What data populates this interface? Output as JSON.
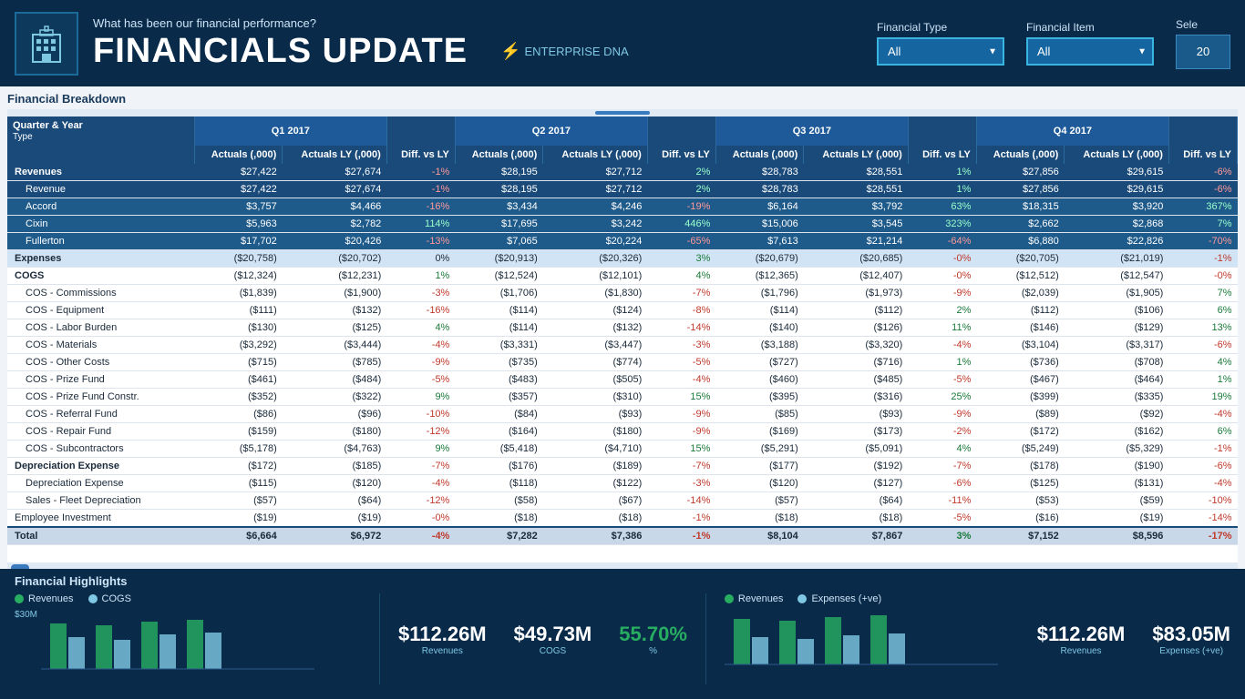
{
  "header": {
    "subtitle": "What has been our financial performance?",
    "title": "FINANCIALS UPDATE",
    "brand": "ENTERPRISE DNA",
    "financial_type_label": "Financial Type",
    "financial_item_label": "Financial Item",
    "select_label": "Sele",
    "financial_type_value": "All",
    "financial_item_value": "All",
    "year_value": "20"
  },
  "table": {
    "section_title": "Financial Breakdown",
    "col_headers": [
      "Quarter & Year",
      "Q1 2017\nActuals (,000)",
      "Actuals LY (,000)",
      "Diff. vs LY",
      "Q2 2017\nActuals (,000)",
      "Actuals LY (,000)",
      "Diff. vs LY",
      "Q3 2017\nActuals (,000)",
      "Actuals LY (,000)",
      "Diff. vs LY",
      "Q4 2017\nActuals (,000)",
      "Actuals LY (,000)",
      "Diff. vs LY"
    ],
    "rows": [
      {
        "label": "Revenues",
        "indent": false,
        "bold": true,
        "group": true,
        "q1a": "$27,422",
        "q1ly": "$27,674",
        "q1d": "-1%",
        "q2a": "$28,195",
        "q2ly": "$27,712",
        "q2d": "2%",
        "q3a": "$28,783",
        "q3ly": "$28,551",
        "q3d": "1%",
        "q4a": "$27,856",
        "q4ly": "$29,615",
        "q4d": "-6%",
        "highlight": true
      },
      {
        "label": "Revenue",
        "indent": true,
        "bold": false,
        "q1a": "$27,422",
        "q1ly": "$27,674",
        "q1d": "-1%",
        "q2a": "$28,195",
        "q2ly": "$27,712",
        "q2d": "2%",
        "q3a": "$28,783",
        "q3ly": "$28,551",
        "q3d": "1%",
        "q4a": "$27,856",
        "q4ly": "$29,615",
        "q4d": "-6%",
        "highlight": true
      },
      {
        "label": "Accord",
        "indent": true,
        "bold": false,
        "q1a": "$3,757",
        "q1ly": "$4,466",
        "q1d": "-16%",
        "q2a": "$3,434",
        "q2ly": "$4,246",
        "q2d": "-19%",
        "q3a": "$6,164",
        "q3ly": "$3,792",
        "q3d": "63%",
        "q4a": "$18,315",
        "q4ly": "$3,920",
        "q4d": "367%",
        "highlight2": true
      },
      {
        "label": "Cixin",
        "indent": true,
        "bold": false,
        "q1a": "$5,963",
        "q1ly": "$2,782",
        "q1d": "114%",
        "q2a": "$17,695",
        "q2ly": "$3,242",
        "q2d": "446%",
        "q3a": "$15,006",
        "q3ly": "$3,545",
        "q3d": "323%",
        "q4a": "$2,662",
        "q4ly": "$2,868",
        "q4d": "7%",
        "highlight2": true
      },
      {
        "label": "Fullerton",
        "indent": true,
        "bold": false,
        "q1a": "$17,702",
        "q1ly": "$20,426",
        "q1d": "-13%",
        "q2a": "$7,065",
        "q2ly": "$20,224",
        "q2d": "-65%",
        "q3a": "$7,613",
        "q3ly": "$21,214",
        "q3d": "-64%",
        "q4a": "$6,880",
        "q4ly": "$22,826",
        "q4d": "-70%",
        "highlight2": true
      },
      {
        "label": "Expenses",
        "indent": false,
        "bold": true,
        "group": true,
        "q1a": "($20,758)",
        "q1ly": "($20,702)",
        "q1d": "0%",
        "q2a": "($20,913)",
        "q2ly": "($20,326)",
        "q2d": "3%",
        "q3a": "($20,679)",
        "q3ly": "($20,685)",
        "q3d": "-0%",
        "q4a": "($20,705)",
        "q4ly": "($21,019)",
        "q4d": "-1%"
      },
      {
        "label": "COGS",
        "indent": false,
        "bold": true,
        "q1a": "($12,324)",
        "q1ly": "($12,231)",
        "q1d": "1%",
        "q2a": "($12,524)",
        "q2ly": "($12,101)",
        "q2d": "4%",
        "q3a": "($12,365)",
        "q3ly": "($12,407)",
        "q3d": "-0%",
        "q4a": "($12,512)",
        "q4ly": "($12,547)",
        "q4d": "-0%"
      },
      {
        "label": "COS - Commissions",
        "indent": true,
        "bold": false,
        "q1a": "($1,839)",
        "q1ly": "($1,900)",
        "q1d": "-3%",
        "q2a": "($1,706)",
        "q2ly": "($1,830)",
        "q2d": "-7%",
        "q3a": "($1,796)",
        "q3ly": "($1,973)",
        "q3d": "-9%",
        "q4a": "($2,039)",
        "q4ly": "($1,905)",
        "q4d": "7%"
      },
      {
        "label": "COS - Equipment",
        "indent": true,
        "bold": false,
        "q1a": "($111)",
        "q1ly": "($132)",
        "q1d": "-16%",
        "q2a": "($114)",
        "q2ly": "($124)",
        "q2d": "-8%",
        "q3a": "($114)",
        "q3ly": "($112)",
        "q3d": "2%",
        "q4a": "($112)",
        "q4ly": "($106)",
        "q4d": "6%"
      },
      {
        "label": "COS - Labor Burden",
        "indent": true,
        "bold": false,
        "q1a": "($130)",
        "q1ly": "($125)",
        "q1d": "4%",
        "q2a": "($114)",
        "q2ly": "($132)",
        "q2d": "-14%",
        "q3a": "($140)",
        "q3ly": "($126)",
        "q3d": "11%",
        "q4a": "($146)",
        "q4ly": "($129)",
        "q4d": "13%"
      },
      {
        "label": "COS - Materials",
        "indent": true,
        "bold": false,
        "q1a": "($3,292)",
        "q1ly": "($3,444)",
        "q1d": "-4%",
        "q2a": "($3,331)",
        "q2ly": "($3,447)",
        "q2d": "-3%",
        "q3a": "($3,188)",
        "q3ly": "($3,320)",
        "q3d": "-4%",
        "q4a": "($3,104)",
        "q4ly": "($3,317)",
        "q4d": "-6%"
      },
      {
        "label": "COS - Other Costs",
        "indent": true,
        "bold": false,
        "q1a": "($715)",
        "q1ly": "($785)",
        "q1d": "-9%",
        "q2a": "($735)",
        "q2ly": "($774)",
        "q2d": "-5%",
        "q3a": "($727)",
        "q3ly": "($716)",
        "q3d": "1%",
        "q4a": "($736)",
        "q4ly": "($708)",
        "q4d": "4%"
      },
      {
        "label": "COS - Prize Fund",
        "indent": true,
        "bold": false,
        "q1a": "($461)",
        "q1ly": "($484)",
        "q1d": "-5%",
        "q2a": "($483)",
        "q2ly": "($505)",
        "q2d": "-4%",
        "q3a": "($460)",
        "q3ly": "($485)",
        "q3d": "-5%",
        "q4a": "($467)",
        "q4ly": "($464)",
        "q4d": "1%"
      },
      {
        "label": "COS - Prize Fund Constr.",
        "indent": true,
        "bold": false,
        "q1a": "($352)",
        "q1ly": "($322)",
        "q1d": "9%",
        "q2a": "($357)",
        "q2ly": "($310)",
        "q2d": "15%",
        "q3a": "($395)",
        "q3ly": "($316)",
        "q3d": "25%",
        "q4a": "($399)",
        "q4ly": "($335)",
        "q4d": "19%"
      },
      {
        "label": "COS - Referral Fund",
        "indent": true,
        "bold": false,
        "q1a": "($86)",
        "q1ly": "($96)",
        "q1d": "-10%",
        "q2a": "($84)",
        "q2ly": "($93)",
        "q2d": "-9%",
        "q3a": "($85)",
        "q3ly": "($93)",
        "q3d": "-9%",
        "q4a": "($89)",
        "q4ly": "($92)",
        "q4d": "-4%"
      },
      {
        "label": "COS - Repair Fund",
        "indent": true,
        "bold": false,
        "q1a": "($159)",
        "q1ly": "($180)",
        "q1d": "-12%",
        "q2a": "($164)",
        "q2ly": "($180)",
        "q2d": "-9%",
        "q3a": "($169)",
        "q3ly": "($173)",
        "q3d": "-2%",
        "q4a": "($172)",
        "q4ly": "($162)",
        "q4d": "6%"
      },
      {
        "label": "COS - Subcontractors",
        "indent": true,
        "bold": false,
        "q1a": "($5,178)",
        "q1ly": "($4,763)",
        "q1d": "9%",
        "q2a": "($5,418)",
        "q2ly": "($4,710)",
        "q2d": "15%",
        "q3a": "($5,291)",
        "q3ly": "($5,091)",
        "q3d": "4%",
        "q4a": "($5,249)",
        "q4ly": "($5,329)",
        "q4d": "-1%"
      },
      {
        "label": "Depreciation Expense",
        "indent": false,
        "bold": true,
        "q1a": "($172)",
        "q1ly": "($185)",
        "q1d": "-7%",
        "q2a": "($176)",
        "q2ly": "($189)",
        "q2d": "-7%",
        "q3a": "($177)",
        "q3ly": "($192)",
        "q3d": "-7%",
        "q4a": "($178)",
        "q4ly": "($190)",
        "q4d": "-6%"
      },
      {
        "label": "Depreciation Expense",
        "indent": true,
        "bold": false,
        "q1a": "($115)",
        "q1ly": "($120)",
        "q1d": "-4%",
        "q2a": "($118)",
        "q2ly": "($122)",
        "q2d": "-3%",
        "q3a": "($120)",
        "q3ly": "($127)",
        "q3d": "-6%",
        "q4a": "($125)",
        "q4ly": "($131)",
        "q4d": "-4%"
      },
      {
        "label": "Sales - Fleet Depreciation",
        "indent": true,
        "bold": false,
        "q1a": "($57)",
        "q1ly": "($64)",
        "q1d": "-12%",
        "q2a": "($58)",
        "q2ly": "($67)",
        "q2d": "-14%",
        "q3a": "($57)",
        "q3ly": "($64)",
        "q3d": "-11%",
        "q4a": "($53)",
        "q4ly": "($59)",
        "q4d": "-10%"
      },
      {
        "label": "Employee Investment",
        "indent": false,
        "bold": false,
        "q1a": "($19)",
        "q1ly": "($19)",
        "q1d": "-0%",
        "q2a": "($18)",
        "q2ly": "($18)",
        "q2d": "-1%",
        "q3a": "($18)",
        "q3ly": "($18)",
        "q3d": "-5%",
        "q4a": "($16)",
        "q4ly": "($19)",
        "q4d": "-14%"
      },
      {
        "label": "Total",
        "indent": false,
        "bold": true,
        "total": true,
        "q1a": "$6,664",
        "q1ly": "$6,972",
        "q1d": "-4%",
        "q2a": "$7,282",
        "q2ly": "$7,386",
        "q2d": "-1%",
        "q3a": "$8,104",
        "q3ly": "$7,867",
        "q3d": "3%",
        "q4a": "$7,152",
        "q4ly": "$8,596",
        "q4d": "-17%"
      }
    ]
  },
  "highlights": {
    "title": "Financial Highlights",
    "legend_revenues": "Revenues",
    "legend_cogs": "COGS",
    "legend_revenues2": "Revenues",
    "legend_expenses": "Expenses (+ve)",
    "revenue_total": "$112.26M",
    "cogs_total": "$49.73M",
    "pct": "55.70%",
    "revenue_total2": "$112.26M",
    "expenses_total": "$83.05M",
    "chart_y_label": "$30M"
  }
}
